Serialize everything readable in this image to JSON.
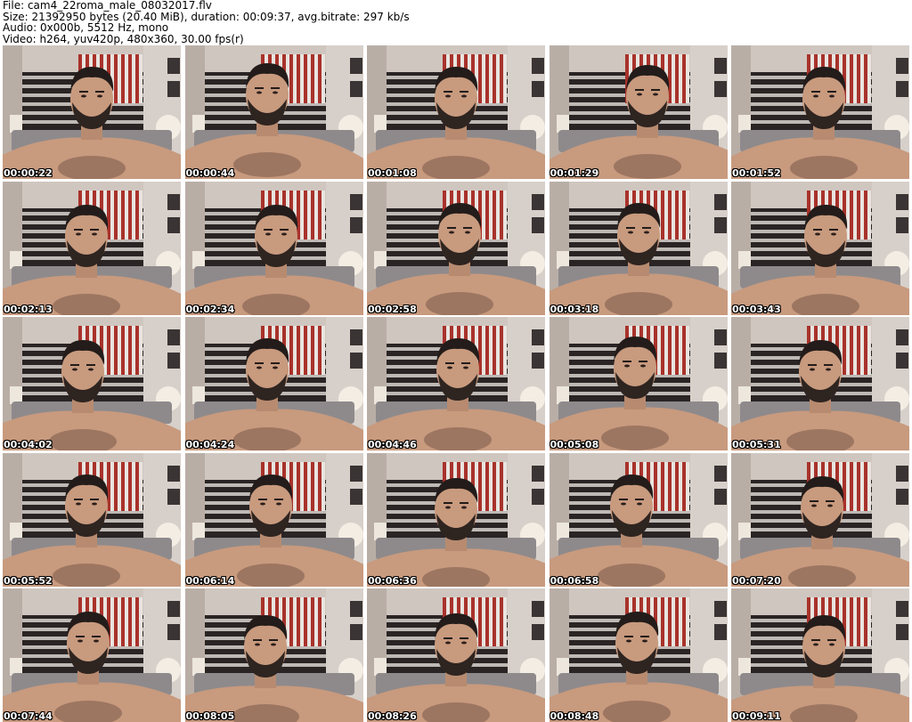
{
  "header": {
    "file_line": "File: cam4_22roma_male_08032017.flv",
    "size_line": "Size: 21392950 bytes (20.40 MiB), duration: 00:09:37, avg.bitrate: 297 kb/s",
    "audio_line": "Audio: 0x000b, 5512 Hz, mono",
    "video_line": "Video: h264, yuv420p, 480x360, 30.00 fps(r)"
  },
  "thumbnails": [
    {
      "timestamp": "00:00:22"
    },
    {
      "timestamp": "00:00:44"
    },
    {
      "timestamp": "00:01:08"
    },
    {
      "timestamp": "00:01:29"
    },
    {
      "timestamp": "00:01:52"
    },
    {
      "timestamp": "00:02:13"
    },
    {
      "timestamp": "00:02:34"
    },
    {
      "timestamp": "00:02:58"
    },
    {
      "timestamp": "00:03:18"
    },
    {
      "timestamp": "00:03:43"
    },
    {
      "timestamp": "00:04:02"
    },
    {
      "timestamp": "00:04:24"
    },
    {
      "timestamp": "00:04:46"
    },
    {
      "timestamp": "00:05:08"
    },
    {
      "timestamp": "00:05:31"
    },
    {
      "timestamp": "00:05:52"
    },
    {
      "timestamp": "00:06:14"
    },
    {
      "timestamp": "00:06:36"
    },
    {
      "timestamp": "00:06:58"
    },
    {
      "timestamp": "00:07:20"
    },
    {
      "timestamp": "00:07:44"
    },
    {
      "timestamp": "00:08:05"
    },
    {
      "timestamp": "00:08:26"
    },
    {
      "timestamp": "00:08:48"
    },
    {
      "timestamp": "00:09:11"
    }
  ],
  "colors": {
    "background": "#ffffff",
    "wall": "#cfc6bf",
    "headboard": "#2a2424",
    "stripe_red": "#a8322b",
    "stripe_white": "#e9e4df",
    "skin": "#c89a7e",
    "hair": "#231c1a",
    "lamp": "#f3ede3",
    "pillow": "#8e8a8c",
    "timestamp_text": "#ffffff"
  }
}
